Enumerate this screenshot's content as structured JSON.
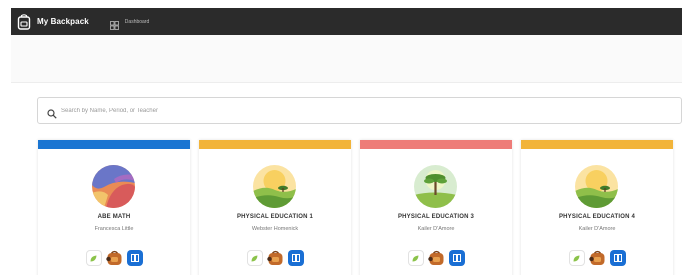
{
  "app": {
    "title": "My Backpack"
  },
  "nav": {
    "dashboard_label": "Dashboard"
  },
  "search": {
    "placeholder": "Search by Name, Period, or Teacher"
  },
  "colors": {
    "topbar": "#2b2b2b",
    "blue": "#1a75d2",
    "yellow": "#f2b43a",
    "coral": "#ee7c78",
    "book_button": "#1a6fd4"
  },
  "cards": [
    {
      "title": "ABE MATH",
      "teacher": "Francesca Little",
      "bar_color": "#1a75d2",
      "avatar": "abstract-art-avatar"
    },
    {
      "title": "PHYSICAL EDUCATION 1",
      "teacher": "Webster Homenick",
      "bar_color": "#f2b43a",
      "avatar": "landscape-avatar"
    },
    {
      "title": "PHYSICAL EDUCATION 3",
      "teacher": "Kailer D'Amore",
      "bar_color": "#ee7c78",
      "avatar": "tree-avatar"
    },
    {
      "title": "PHYSICAL EDUCATION 4",
      "teacher": "Kailer D'Amore",
      "bar_color": "#f2b43a",
      "avatar": "landscape-avatar"
    }
  ]
}
